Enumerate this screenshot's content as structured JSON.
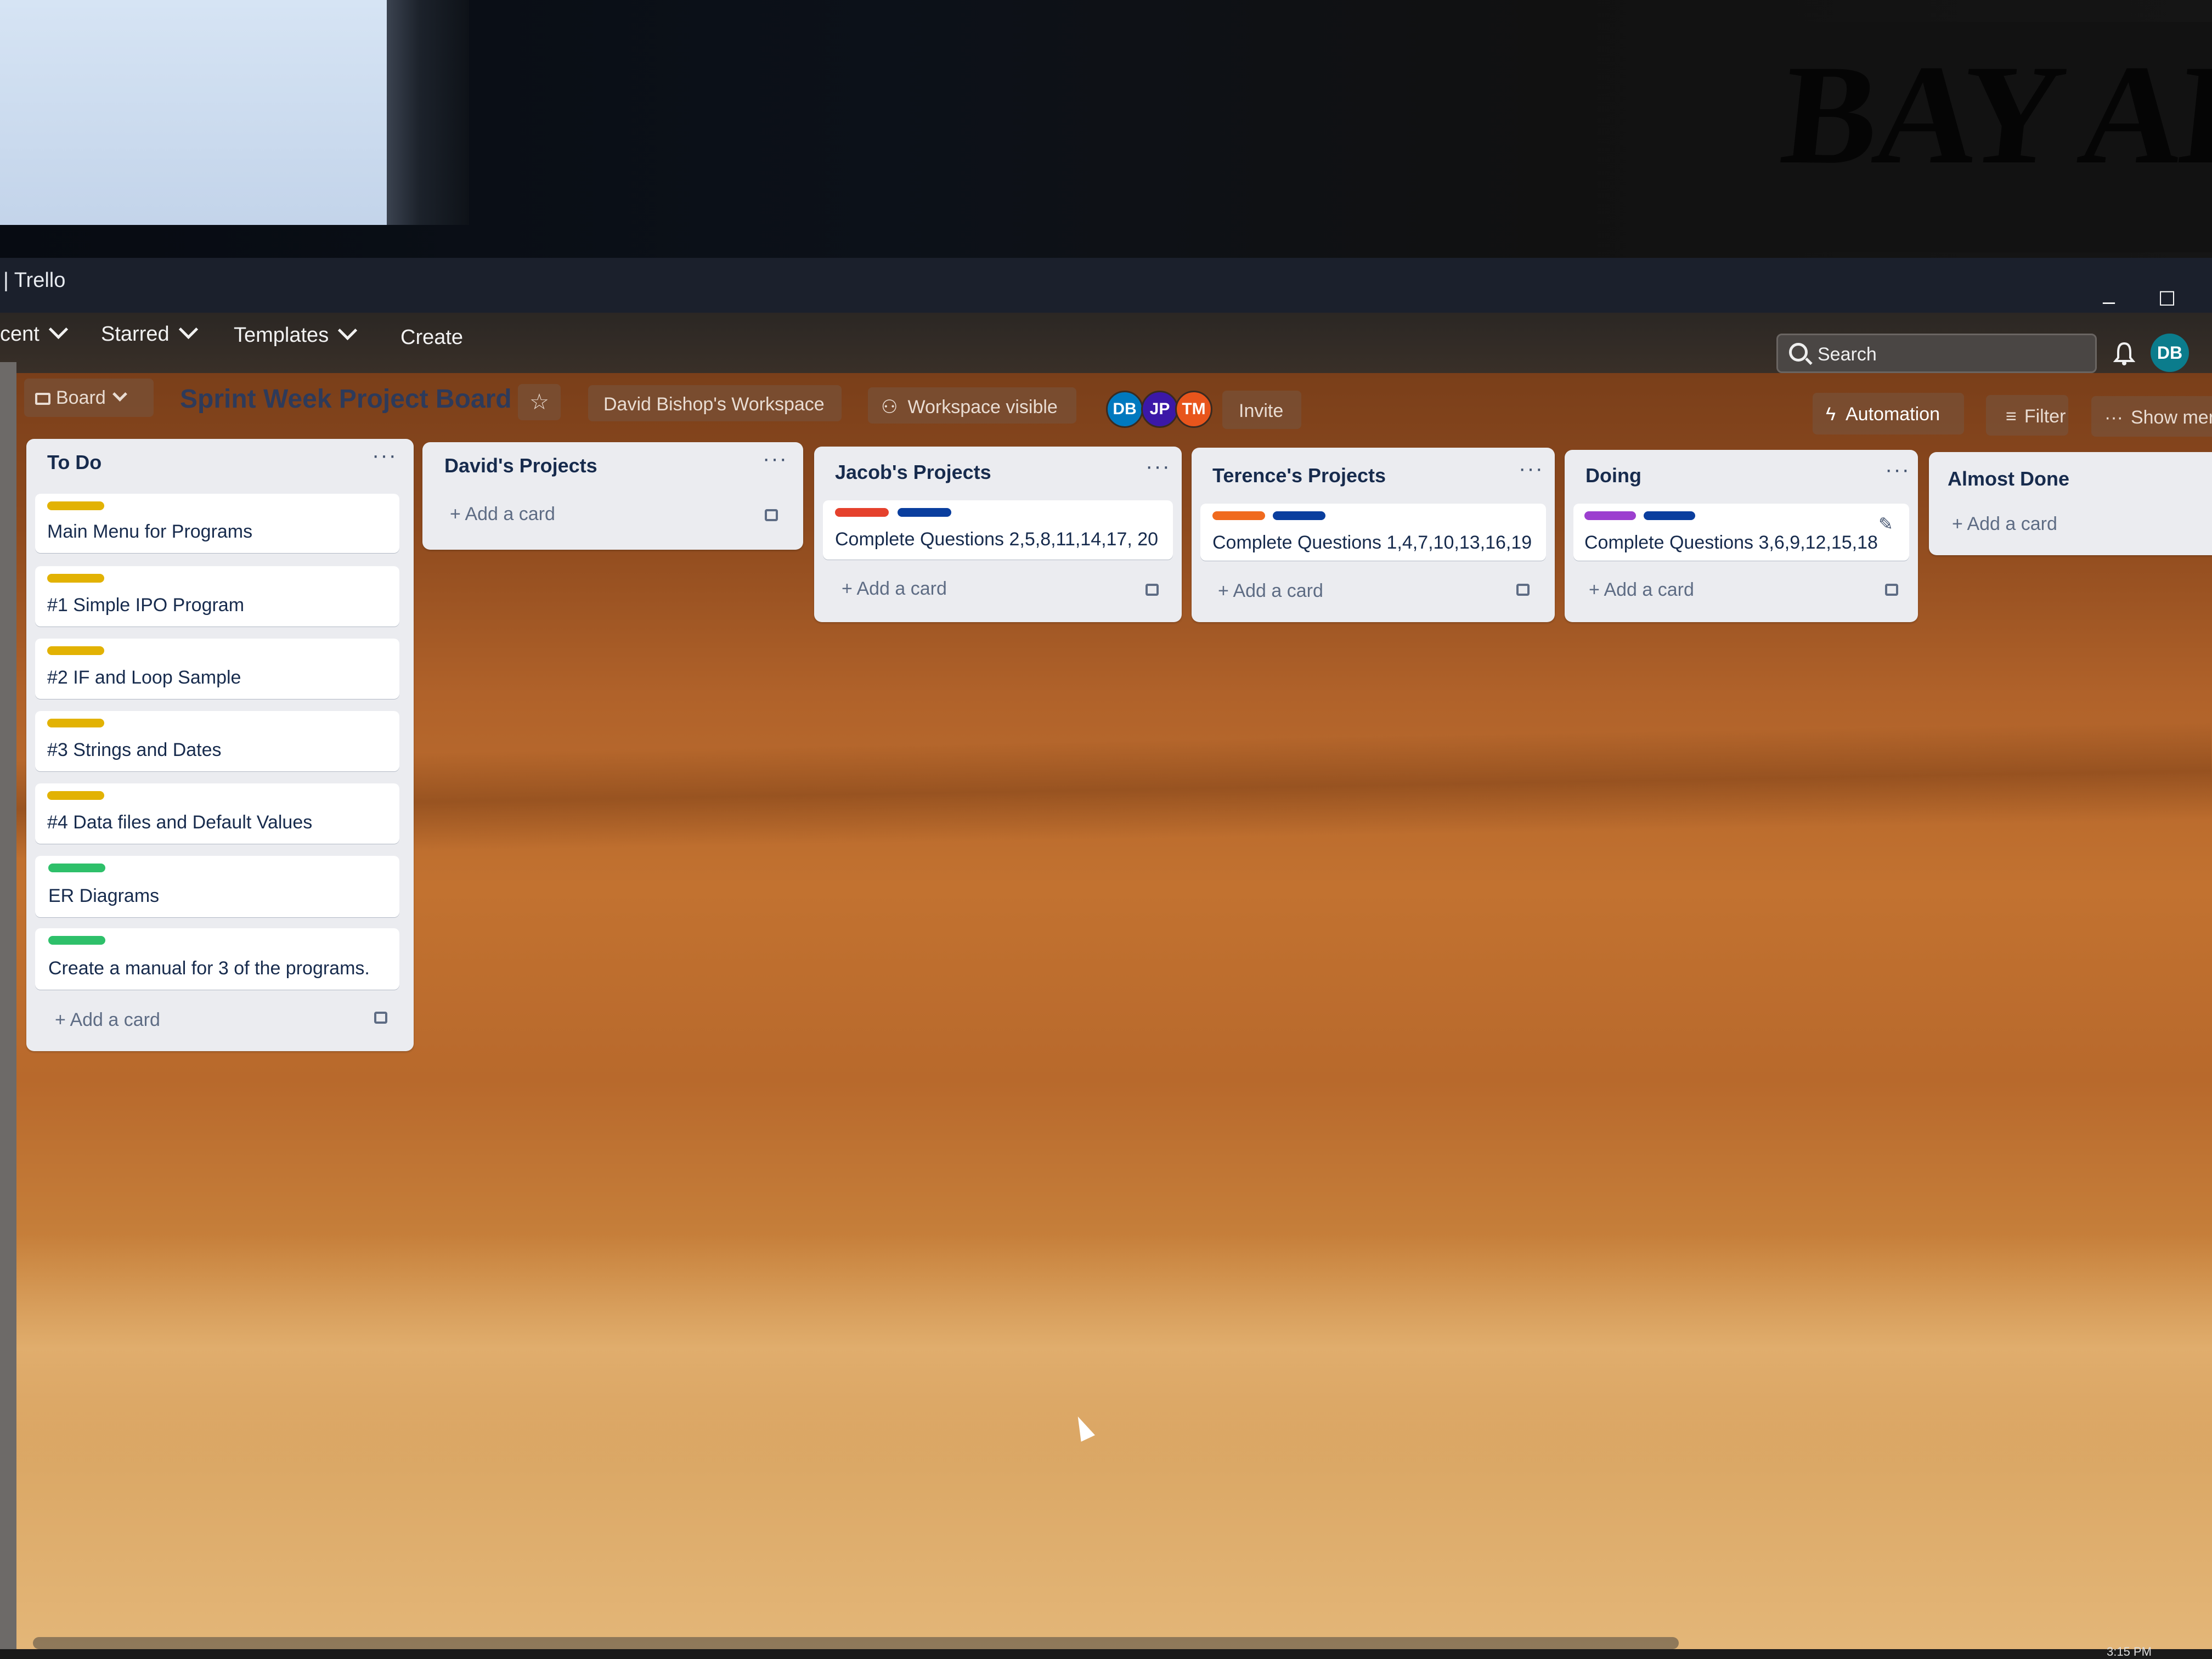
{
  "window": {
    "title": "| Trello",
    "minimize": "–",
    "maximize": "☐"
  },
  "background_poster": "BAY ARENA",
  "nav": {
    "recent_label": "cent",
    "starred_label": "Starred",
    "templates_label": "Templates",
    "create_label": "Create"
  },
  "search": {
    "placeholder": "Search"
  },
  "user_avatar": "DB",
  "board": {
    "view_label": "Board",
    "title": "Sprint Week Project Board",
    "workspace_label": "David Bishop's Workspace",
    "visibility_label": "Workspace visible",
    "members": [
      {
        "initials": "DB",
        "color": "#0079bf"
      },
      {
        "initials": "JP",
        "color": "#3b18a8"
      },
      {
        "initials": "TM",
        "color": "#e8551c"
      }
    ],
    "invite_label": "Invite",
    "automation_label": "Automation",
    "filter_label": "Filter",
    "show_menu_label": "Show mer"
  },
  "lists": [
    {
      "title": "To Do",
      "cards": [
        {
          "label_colors": [
            "#e2b203"
          ],
          "text": "Main Menu for Programs"
        },
        {
          "label_colors": [
            "#e2b203"
          ],
          "text": "#1 Simple IPO Program"
        },
        {
          "label_colors": [
            "#e2b203"
          ],
          "text": "#2 IF and Loop Sample"
        },
        {
          "label_colors": [
            "#e2b203"
          ],
          "text": "#3 Strings and Dates"
        },
        {
          "label_colors": [
            "#e2b203"
          ],
          "text": "#4 Data files and Default Values"
        },
        {
          "label_colors": [
            "#2ec06a"
          ],
          "text": "ER Diagrams"
        },
        {
          "label_colors": [
            "#2ec06a"
          ],
          "text": "Create a manual for 3 of the programs."
        }
      ],
      "add_label": "Add a card"
    },
    {
      "title": "David's Projects",
      "cards": [],
      "add_label": "Add a card"
    },
    {
      "title": "Jacob's Projects",
      "cards": [
        {
          "label_colors": [
            "#e5412d",
            "#0a3e9e"
          ],
          "text": "Complete Questions 2,5,8,11,14,17, 20"
        }
      ],
      "add_label": "Add a card"
    },
    {
      "title": "Terence's Projects",
      "cards": [
        {
          "label_colors": [
            "#f06a1e",
            "#0a3e9e"
          ],
          "text": "Complete Questions 1,4,7,10,13,16,19"
        }
      ],
      "add_label": "Add a card"
    },
    {
      "title": "Doing",
      "cards": [
        {
          "label_colors": [
            "#9c3fcf",
            "#0a3e9e"
          ],
          "text": "Complete Questions 3,6,9,12,15,18"
        }
      ],
      "add_label": "Add a card"
    },
    {
      "title": "Almost Done",
      "cards": [],
      "add_label": "Add a card"
    }
  ],
  "clock": "3:15 PM"
}
